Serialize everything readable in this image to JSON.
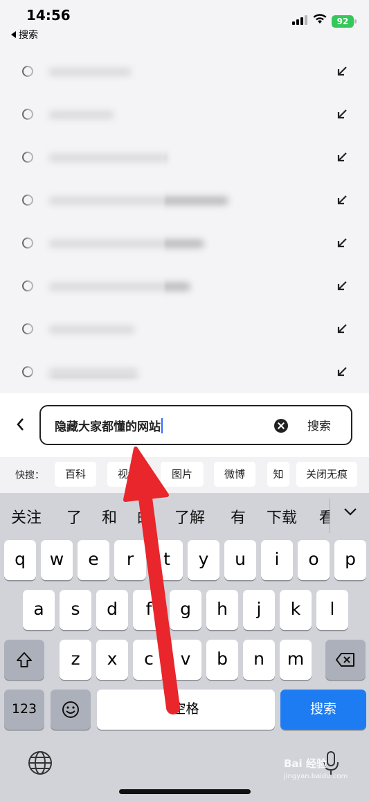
{
  "status_bar": {
    "time": "14:56",
    "back_app": "搜索",
    "battery": "92"
  },
  "history": {
    "row_count": 8,
    "icons": [
      "clock-icon",
      "fill-arrow-icon"
    ]
  },
  "search": {
    "query": "隐藏大家都懂的网站",
    "button_label": "搜索"
  },
  "quick_search": {
    "label": "快搜：",
    "chips": [
      "百科",
      "视频",
      "图片",
      "微博",
      "知",
      "关闭无痕"
    ]
  },
  "keyboard": {
    "candidates": [
      "关注",
      "了",
      "和",
      "的",
      "了解",
      "有",
      "下载",
      "看"
    ],
    "row1": [
      "q",
      "w",
      "e",
      "r",
      "t",
      "y",
      "u",
      "i",
      "o",
      "p"
    ],
    "row2": [
      "a",
      "s",
      "d",
      "f",
      "g",
      "h",
      "j",
      "k",
      "l"
    ],
    "row3": [
      "z",
      "x",
      "c",
      "v",
      "b",
      "n",
      "m"
    ],
    "numbers_key": "123",
    "space_key": "空格",
    "return_key": "搜索"
  },
  "watermark": {
    "brand": "Bai 经验",
    "url": "jingyan.baidu.com"
  },
  "colors": {
    "accent_blue": "#1e7cf2",
    "annotation_red": "#e8262b",
    "battery_green": "#34c759"
  }
}
